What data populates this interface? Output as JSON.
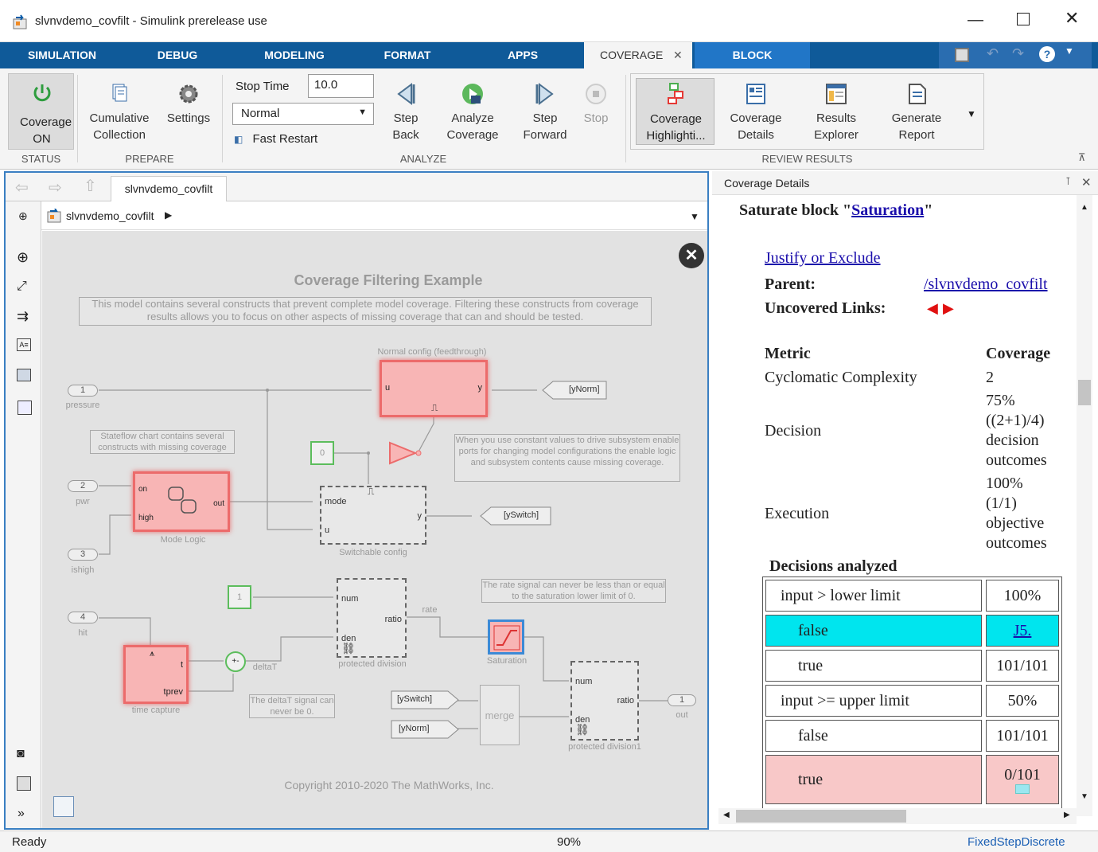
{
  "window": {
    "title": "slvnvdemo_covfilt - Simulink prerelease use",
    "controls": [
      "minimize",
      "maximize",
      "close"
    ]
  },
  "tabs": [
    {
      "label": "SIMULATION"
    },
    {
      "label": "DEBUG"
    },
    {
      "label": "MODELING"
    },
    {
      "label": "FORMAT"
    },
    {
      "label": "APPS"
    },
    {
      "label": "COVERAGE",
      "closable": true,
      "active": true
    },
    {
      "label": "BLOCK"
    }
  ],
  "ribbon": {
    "status": {
      "label": "STATUS",
      "coverage_btn": "Coverage ON"
    },
    "prepare": {
      "label": "PREPARE",
      "cumulative_btn": "Cumulative Collection",
      "settings_btn": "Settings"
    },
    "analyze": {
      "label": "ANALYZE",
      "stop_time_label": "Stop Time",
      "stop_time_value": "10.0",
      "mode_value": "Normal",
      "fast_restart": "Fast Restart",
      "step_back": "Step Back",
      "analyze_coverage": "Analyze Coverage",
      "step_forward": "Step Forward",
      "stop": "Stop"
    },
    "review": {
      "label": "REVIEW RESULTS",
      "highlighting": "Coverage Highlighti...",
      "details": "Coverage Details",
      "explorer": "Results Explorer",
      "report": "Generate Report"
    }
  },
  "canvas": {
    "tab_label": "slvnvdemo_covfilt",
    "breadcrumb": "slvnvdemo_covfilt",
    "diagram": {
      "title": "Coverage Filtering Example",
      "description": "This model contains several constructs that prevent complete model coverage. Filtering these constructs from coverage results allows you to focus on other aspects of missing coverage that can and should be tested.",
      "normal_config_label": "Normal config (feedthrough)",
      "stateflow_note": "Stateflow chart contains several constructs with missing coverage",
      "enable_note": "When you use constant values to drive subsystem enable ports for changing model configurations the enable logic and subsystem contents cause missing coverage.",
      "rate_note": "The rate signal can never be less than or equal to the saturation lower limit of 0.",
      "deltat_note": "The deltaT signal can never be 0.",
      "inports": [
        {
          "num": "1",
          "name": "pressure"
        },
        {
          "num": "2",
          "name": "pwr"
        },
        {
          "num": "3",
          "name": "ishigh"
        },
        {
          "num": "4",
          "name": "hit"
        }
      ],
      "outport": {
        "num": "1",
        "name": "out"
      },
      "goto_tags": {
        "ynorm": "[yNorm]",
        "yswitch": "[ySwitch]"
      },
      "from_tags": {
        "yswitch": "[ySwitch]",
        "ynorm": "[yNorm]"
      },
      "const0": "0",
      "const1": "1",
      "mode_logic": {
        "name": "Mode Logic",
        "in1": "on",
        "in2": "high",
        "out": "out"
      },
      "switchable": {
        "name": "Switchable config",
        "in1": "mode",
        "in2": "u",
        "out": "y"
      },
      "normal_block": {
        "in": "u",
        "out": "y"
      },
      "time_capture": {
        "name": "time capture",
        "out1": "t",
        "out2": "tprev"
      },
      "deltaT": "deltaT",
      "sum_label": "+-",
      "protected_div": {
        "name": "protected division",
        "in1": "num",
        "in2": "den",
        "out": "ratio"
      },
      "rate_label": "rate",
      "saturation": "Saturation",
      "merge": "merge",
      "protected_div1": {
        "name": "protected division1",
        "in1": "num",
        "in2": "den",
        "out": "ratio"
      },
      "copyright": "Copyright 2010-2020 The MathWorks, Inc."
    }
  },
  "details": {
    "panel_title": "Coverage Details",
    "heading_prefix": "Saturate block \"",
    "heading_link": "Saturation",
    "heading_suffix": "\"",
    "justify_link": "Justify or Exclude",
    "parent_label": "Parent:",
    "parent_link": "/slvnvdemo_covfilt",
    "uncovered_label": "Uncovered Links:",
    "metric_header": "Metric",
    "coverage_header": "Coverage",
    "metrics": [
      {
        "name": "Cyclomatic Complexity",
        "value": "2"
      },
      {
        "name": "Decision",
        "value_lines": [
          "75%",
          "((2+1)/4)",
          "decision",
          "outcomes"
        ]
      },
      {
        "name": "Execution",
        "value_lines": [
          "100%",
          "(1/1)",
          "objective",
          "outcomes"
        ]
      }
    ],
    "decisions_heading": "Decisions analyzed",
    "decisions": [
      {
        "label": "input > lower limit",
        "value": "100%",
        "style": "head"
      },
      {
        "label": "false",
        "value": "J5.",
        "style": "cyan",
        "value_link": true
      },
      {
        "label": "true",
        "value": "101/101",
        "style": "plain"
      },
      {
        "label": "input >= upper limit",
        "value": "50%",
        "style": "head"
      },
      {
        "label": "false",
        "value": "101/101",
        "style": "plain"
      },
      {
        "label": "true",
        "value": "0/101",
        "style": "red"
      }
    ]
  },
  "status": {
    "left": "Ready",
    "zoom": "90%",
    "solver": "FixedStepDiscrete"
  },
  "colors": {
    "tab_blue": "#0f5a99",
    "block_tab": "#2176c7",
    "uncovered_red": "#f8b5b5",
    "justified_cyan": "#00e5ee"
  }
}
